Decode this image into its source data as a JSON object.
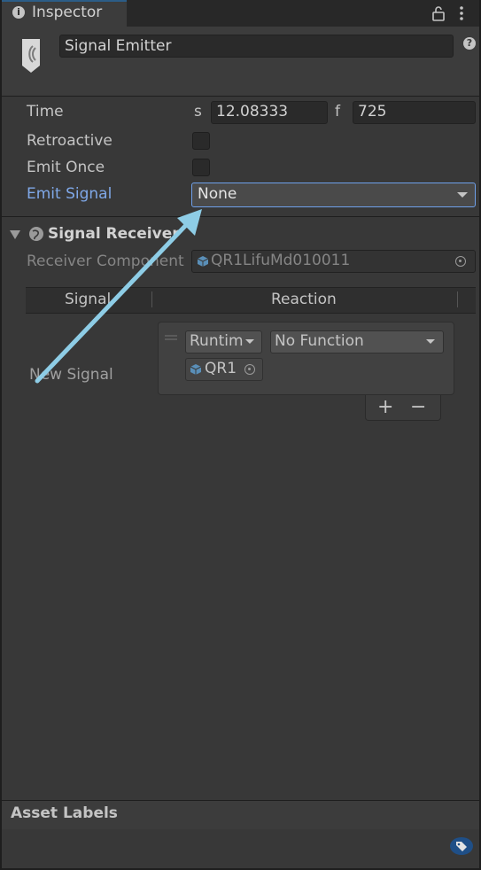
{
  "window": {
    "tab_title": "Inspector",
    "tab_icon": "info-icon",
    "lock_icon": "lock-icon",
    "menu_icon": "kebab-menu-icon"
  },
  "header": {
    "object_name": "Signal Emitter",
    "help_icon": "?"
  },
  "properties": {
    "time_label": "Time",
    "time_seconds_label": "s",
    "time_seconds_value": "12.08333",
    "time_frames_label": "f",
    "time_frames_value": "725",
    "retroactive_label": "Retroactive",
    "retroactive_checked": false,
    "emit_once_label": "Emit Once",
    "emit_once_checked": false,
    "emit_signal_label": "Emit Signal",
    "emit_signal_value": "None"
  },
  "signal_receiver": {
    "title": "Signal Receiver",
    "receiver_component_label": "Receiver Component",
    "receiver_component_value": "QR1LifuMd010011",
    "columns": [
      "Signal",
      "Reaction"
    ],
    "rows": [
      {
        "signal": "New Signal",
        "runtime_mode": "Runtim",
        "function": "No Function",
        "target_object": "QR1"
      }
    ],
    "add_button": "+",
    "remove_button": "−"
  },
  "footer": {
    "asset_labels_title": "Asset Labels",
    "tag_icon": "tag-icon"
  },
  "colors": {
    "background": "#383838",
    "accent_blue": "#6fa0ea",
    "arrow": "#8ecde6"
  }
}
